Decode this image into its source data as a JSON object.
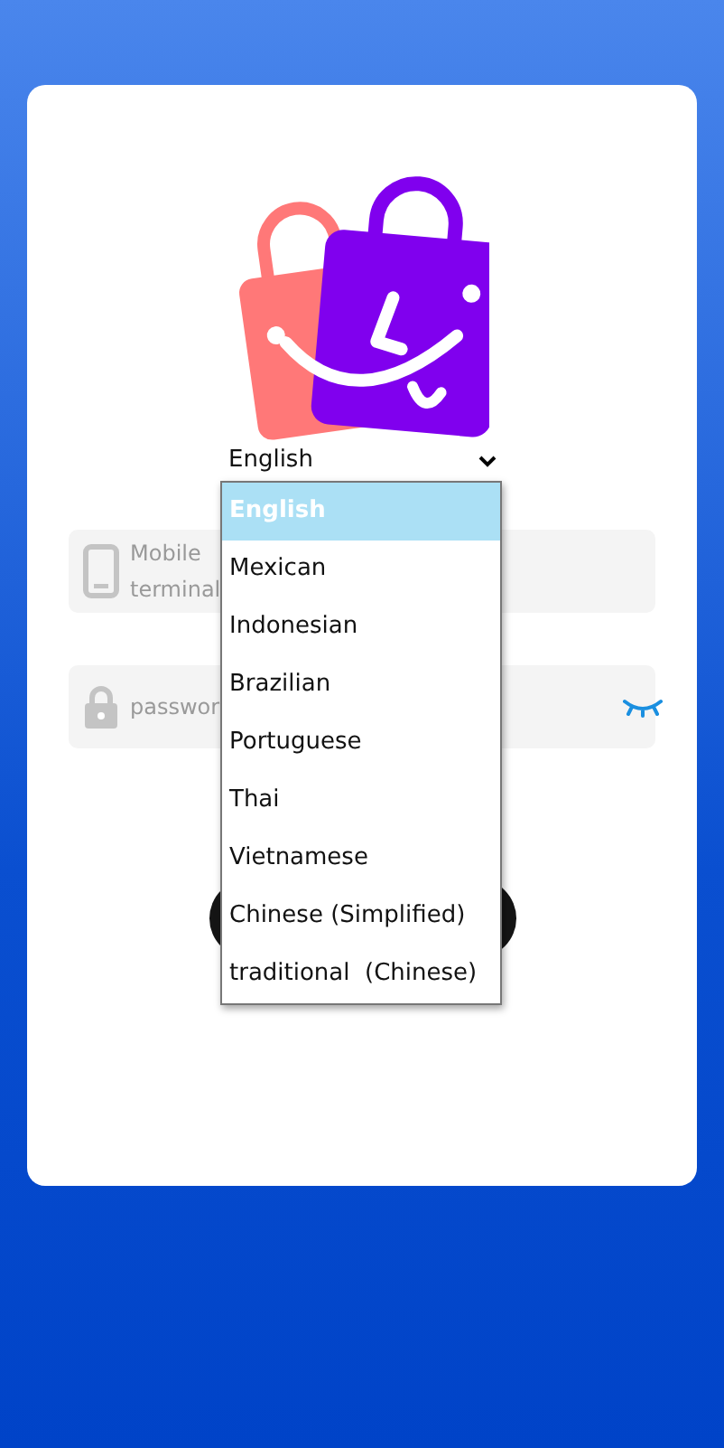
{
  "language_select": {
    "value": "English"
  },
  "language_options": [
    {
      "label": "English",
      "selected": true
    },
    {
      "label": "Mexican",
      "selected": false
    },
    {
      "label": "Indonesian",
      "selected": false
    },
    {
      "label": "Brazilian",
      "selected": false
    },
    {
      "label": "Portuguese",
      "selected": false
    },
    {
      "label": "Thai",
      "selected": false
    },
    {
      "label": "Vietnamese",
      "selected": false
    },
    {
      "label": "Chinese (Simplified)",
      "selected": false
    },
    {
      "label": "traditional  (Chinese)",
      "selected": false
    }
  ],
  "phone_field": {
    "placeholder": "Mobile terminal"
  },
  "password_field": {
    "placeholder": "passwor",
    "password_visible": false
  }
}
